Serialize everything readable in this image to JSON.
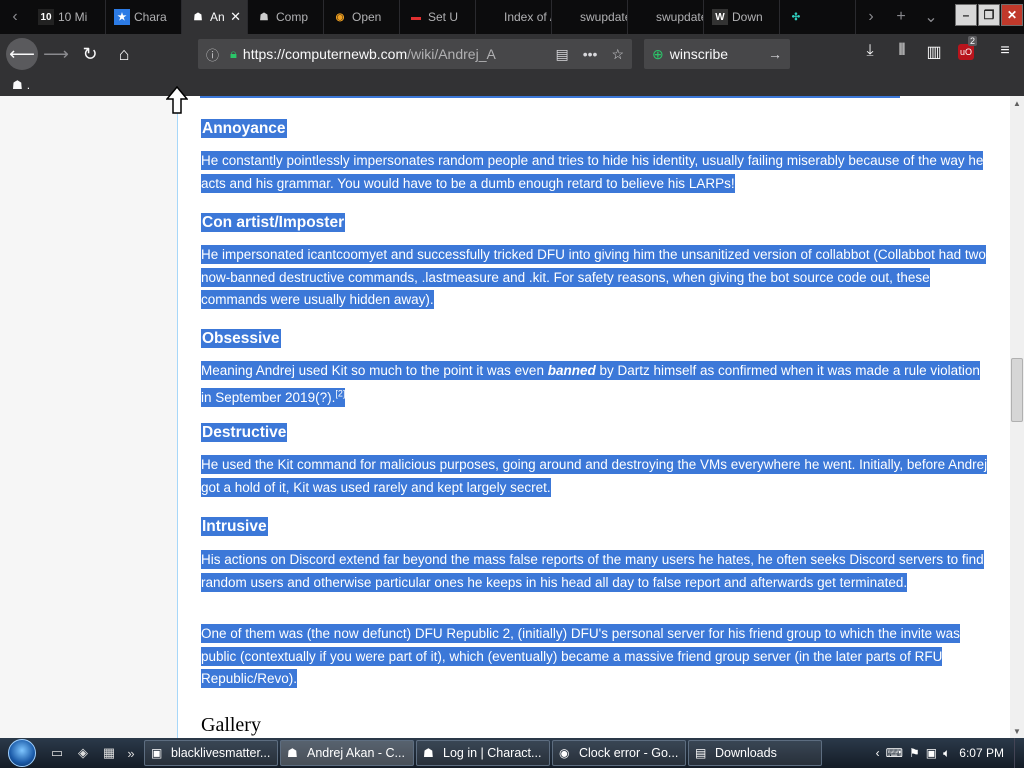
{
  "tabs": [
    {
      "label": "10 Mi",
      "fav": "10",
      "favColor": "#ffffff",
      "favBg": "#222222"
    },
    {
      "label": "Chara",
      "fav": "★",
      "favColor": "#ffffff",
      "favBg": "#2c7be5"
    },
    {
      "label": "An",
      "fav": "☗",
      "favColor": "#ffffff",
      "favBg": "transparent",
      "active": true
    },
    {
      "label": "Comp",
      "fav": "☗",
      "favColor": "#cccccc",
      "favBg": "transparent"
    },
    {
      "label": "Open",
      "fav": "◉",
      "favColor": "#f0a020",
      "favBg": "transparent"
    },
    {
      "label": "Set U",
      "fav": "▬",
      "favColor": "#e03030",
      "favBg": "transparent"
    },
    {
      "label": "Index of /",
      "fav": "",
      "favColor": "#cccccc",
      "favBg": "transparent"
    },
    {
      "label": "swupdate",
      "fav": "",
      "favColor": "#cccccc",
      "favBg": "transparent"
    },
    {
      "label": "swupdate",
      "fav": "",
      "favColor": "#cccccc",
      "favBg": "transparent"
    },
    {
      "label": "Down",
      "fav": "W",
      "favColor": "#ffffff",
      "favBg": "#333333"
    },
    {
      "label": "",
      "fav": "✣",
      "favColor": "#30d0c0",
      "favBg": "transparent"
    }
  ],
  "url": {
    "host": "https://computernewb.com",
    "path": "/wiki/Andrej_A"
  },
  "search": {
    "value": "winscribe"
  },
  "ublock_badge": "2",
  "bookmark_label": ".",
  "article": {
    "sections": [
      {
        "heading": "Annoyance",
        "paras": [
          "He constantly pointlessly impersonates random people and tries to hide his identity, usually failing miserably because of the way he acts and his grammar. You would have to be a dumb enough retard to believe his LARPs!"
        ]
      },
      {
        "heading": "Con artist/Imposter",
        "paras": [
          "He impersonated icantcoomyet and successfully tricked DFU into giving him the unsanitized version of collabbot (Collabbot had two now-banned destructive commands, .lastmeasure and .kit. For safety reasons, when giving the bot source code out, these commands were usually hidden away)."
        ]
      },
      {
        "heading": "Obsessive",
        "paras": []
      },
      {
        "heading": "Destructive",
        "paras": [
          "He used the Kit command for malicious purposes, going around and destroying the VMs everywhere he went. Initially, before Andrej got a hold of it, Kit was used rarely and kept largely secret."
        ]
      },
      {
        "heading": "Intrusive",
        "paras": [
          "His actions on Discord extend far beyond the mass false reports of the many users he hates, he often seeks Discord servers to find random users and otherwise particular ones he keeps in his head all day to false report and afterwards get terminated.",
          "One of them was (the now defunct) DFU Republic 2, (initially) DFU's personal server for his friend group to which the invite was public (contextually if you were part of it), which (eventually) became a massive friend group server (in the later parts of RFU Republic/Revo)."
        ]
      }
    ],
    "obsessive_pre": "Meaning Andrej used Kit so much to the point it was even ",
    "obsessive_em": "banned",
    "obsessive_post": " by Dartz himself as confirmed when it was made a rule violation in September 2019(?).",
    "obsessive_ref": "[2]",
    "gallery": "Gallery"
  },
  "taskbar": {
    "tasks": [
      {
        "label": "blacklivesmatter...",
        "icon": "▣"
      },
      {
        "label": "Andrej Akan - C...",
        "icon": "☗",
        "active": true
      },
      {
        "label": "Log in | Charact...",
        "icon": "☗"
      },
      {
        "label": "Clock error - Go...",
        "icon": "◉"
      },
      {
        "label": "Downloads",
        "icon": "▤"
      }
    ],
    "clock": "6:07 PM"
  }
}
